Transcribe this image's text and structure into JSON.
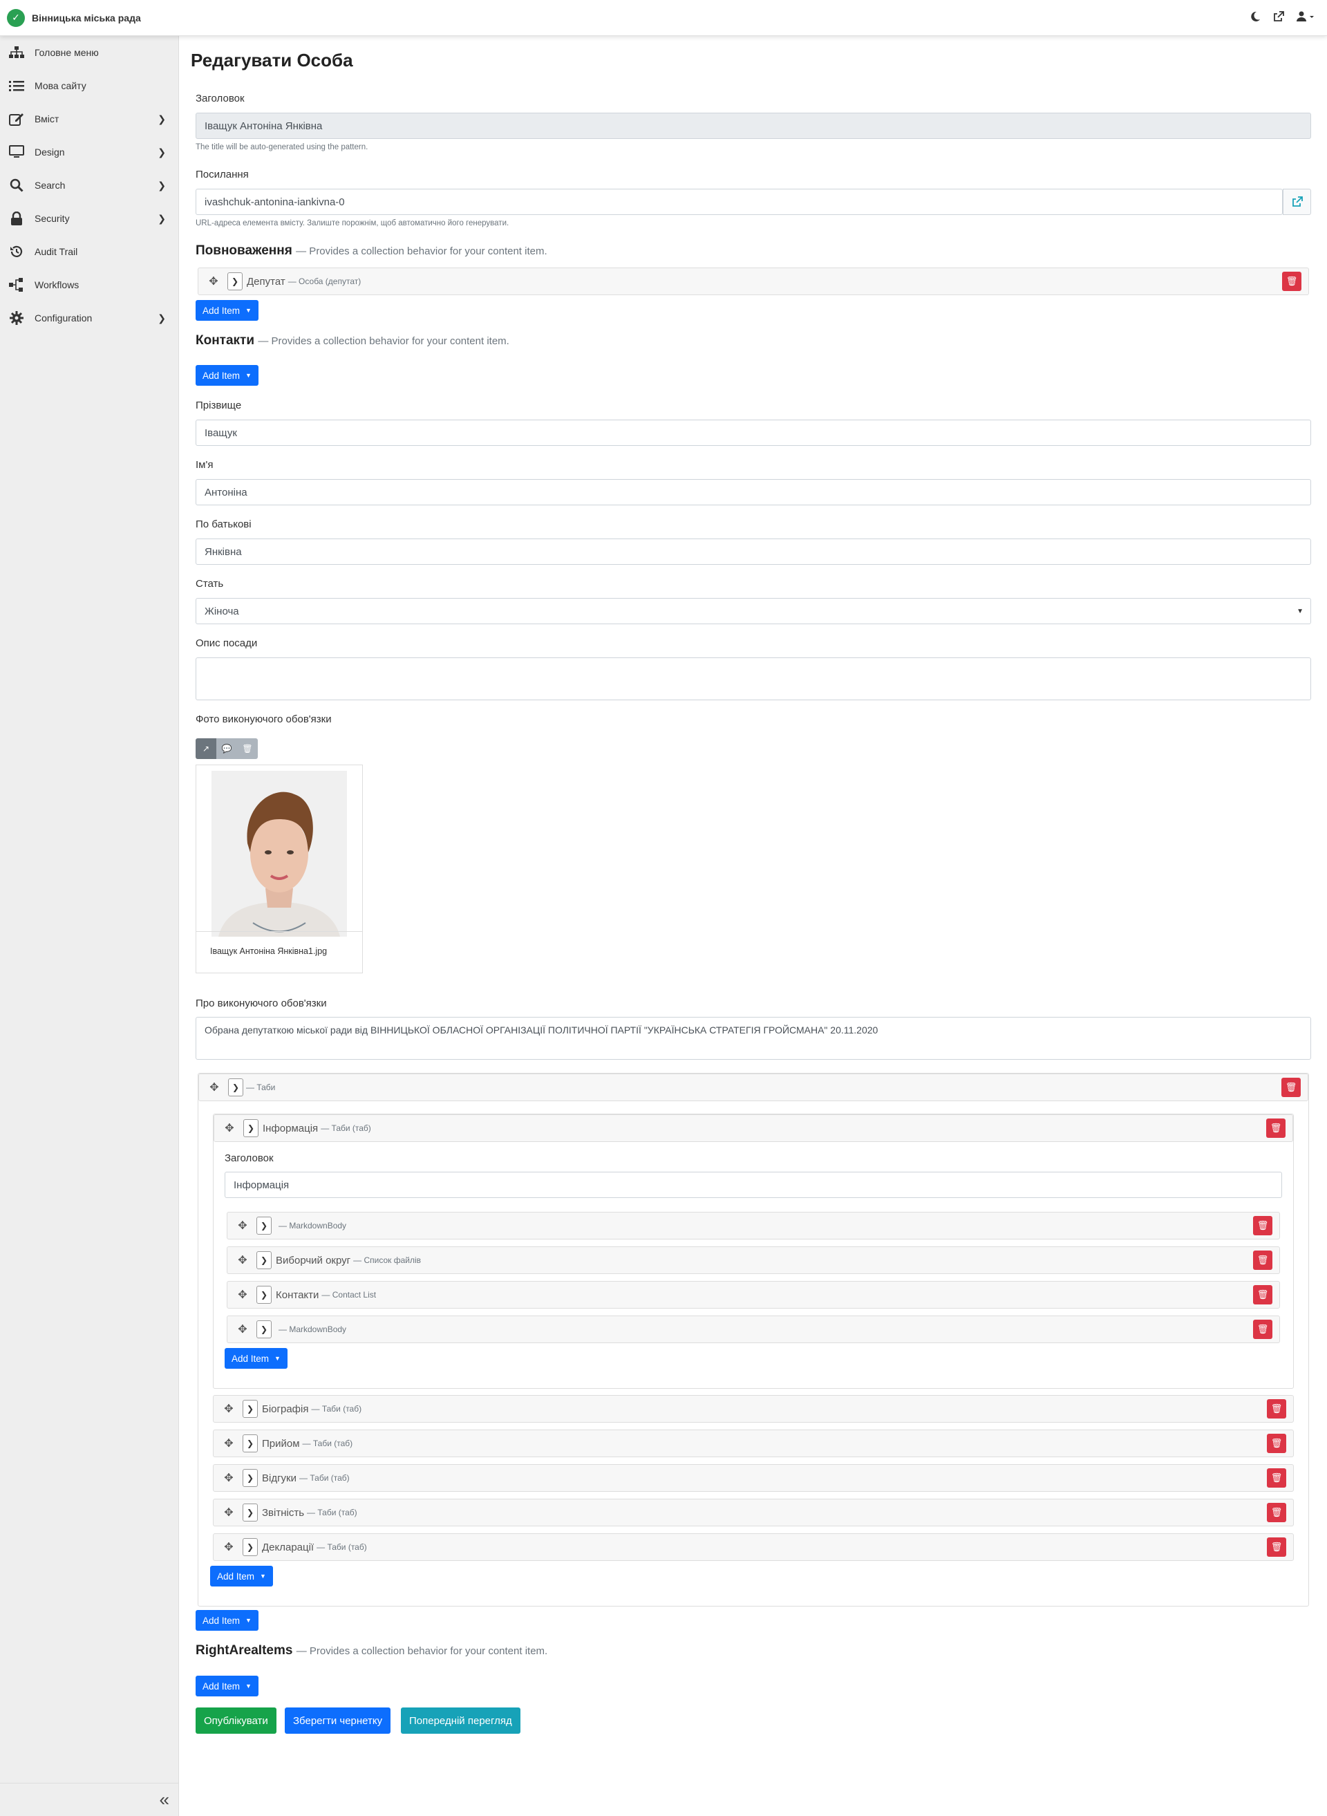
{
  "app": {
    "brand": "Вінницька міська рада"
  },
  "sidebar": {
    "items": [
      {
        "label": "Головне меню",
        "icon": "sitemap-icon",
        "chevron": false
      },
      {
        "label": "Мова сайту",
        "icon": "list-icon",
        "chevron": false
      },
      {
        "label": "Вміст",
        "icon": "edit-icon",
        "chevron": true
      },
      {
        "label": "Design",
        "icon": "monitor-icon",
        "chevron": true
      },
      {
        "label": "Search",
        "icon": "search-icon",
        "chevron": true
      },
      {
        "label": "Security",
        "icon": "lock-icon",
        "chevron": true
      },
      {
        "label": "Audit Trail",
        "icon": "history-icon",
        "chevron": false
      },
      {
        "label": "Workflows",
        "icon": "workflow-icon",
        "chevron": false
      },
      {
        "label": "Configuration",
        "icon": "gear-icon",
        "chevron": true
      }
    ]
  },
  "page": {
    "title": "Редагувати Особа"
  },
  "form": {
    "title_label": "Заголовок",
    "title_value": "Іващук Антоніна Янківна",
    "title_hint": "The title will be auto-generated using the pattern.",
    "link_label": "Посилання",
    "link_value": "ivashchuk-antonina-iankivna-0",
    "link_hint": "URL-адреса елемента вмісту. Залиште порожнім, щоб автоматично його генерувати.",
    "powers_title": "Повноваження",
    "collection_desc": "— Provides a collection behavior for your content item.",
    "powers_item_title": "Депутат",
    "powers_item_sub": "— Особа (депутат)",
    "add_item": "Add Item",
    "contacts_title": "Контакти",
    "surname_label": "Прізвище",
    "surname_value": "Іващук",
    "name_label": "Ім'я",
    "name_value": "Антоніна",
    "patronymic_label": "По батькові",
    "patronymic_value": "Янківна",
    "gender_label": "Стать",
    "gender_value": "Жіноча",
    "position_label": "Опис посади",
    "position_value": "",
    "photo_label": "Фото виконуючого обов'язки",
    "photo_filename": "Іващук Антоніна Янківна1.jpg",
    "about_label": "Про виконуючого обов'язки",
    "about_value": "Обрана депутаткою міської ради від ВІННИЦЬКОЇ ОБЛАСНОЇ ОРГАНІЗАЦІЇ ПОЛІТИЧНОЇ ПАРТІЇ \"УКРАЇНСЬКА СТРАТЕГІЯ ГРОЙСМАНА\"  20.11.2020",
    "tabs_sub": "— Таби",
    "info_title": "Інформація",
    "info_sub": "— Таби (таб)",
    "info_header_label": "Заголовок",
    "info_header_value": "Інформація",
    "widgets": [
      {
        "title": "",
        "sub": "— MarkdownBody"
      },
      {
        "title": "Виборчий округ",
        "sub": "— Список файлів"
      },
      {
        "title": "Контакти",
        "sub": "— Contact List"
      },
      {
        "title": "",
        "sub": "— MarkdownBody"
      }
    ],
    "tabs": [
      {
        "title": "Біографія",
        "sub": "— Таби (таб)"
      },
      {
        "title": "Прийом",
        "sub": "— Таби (таб)"
      },
      {
        "title": "Відгуки",
        "sub": "— Таби (таб)"
      },
      {
        "title": "Звітність",
        "sub": "— Таби (таб)"
      },
      {
        "title": "Декларації",
        "sub": "— Таби (таб)"
      }
    ],
    "right_title": "RightAreaItems",
    "publish": "Опублікувати",
    "save_draft": "Зберегти чернетку",
    "preview": "Попередній перегляд"
  },
  "colors": {
    "primary": "#0d6efd",
    "danger": "#dc3545",
    "success": "#198754",
    "info": "#17a2b8",
    "brand": "#2aa053"
  }
}
